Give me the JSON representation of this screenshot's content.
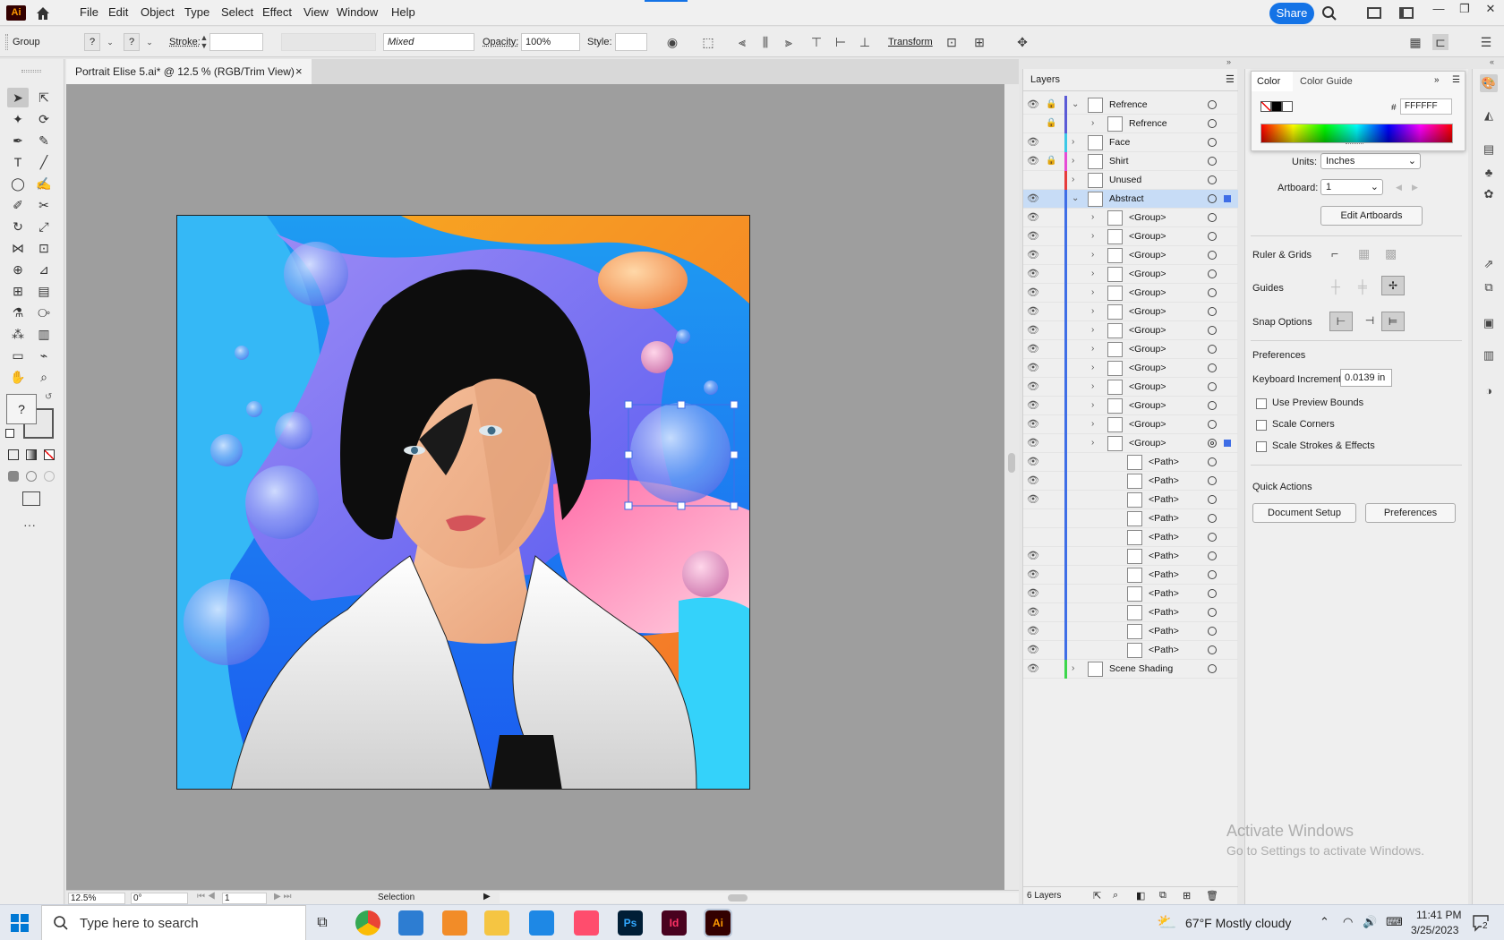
{
  "app": {
    "logo": "Ai",
    "home_icon": "home-icon"
  },
  "menu": [
    "File",
    "Edit",
    "Object",
    "Type",
    "Select",
    "Effect",
    "View",
    "Window",
    "Help"
  ],
  "topbar": {
    "share": "Share"
  },
  "control": {
    "selection_type": "Group",
    "fill_q": "?",
    "stroke_q": "?",
    "stroke_label": "Stroke:",
    "mixed": "Mixed",
    "opacity_label": "Opacity:",
    "opacity_value": "100%",
    "style_label": "Style:",
    "transform": "Transform"
  },
  "document": {
    "tab_title": "Portrait Elise 5.ai* @ 12.5 % (RGB/Trim View)",
    "close": "×"
  },
  "status": {
    "zoom": "12.5%",
    "rotation": "0°",
    "artboard": "1",
    "tool": "Selection"
  },
  "layers": {
    "panel_title": "Layers",
    "count": "6 Layers",
    "rows": [
      {
        "name": "Refrence",
        "eye": true,
        "lock": true,
        "expanded": true,
        "color": "#5b5bd6",
        "indent": 0
      },
      {
        "name": "Refrence",
        "eye": false,
        "lock": true,
        "color": "#5b5bd6",
        "indent": 1
      },
      {
        "name": "Face",
        "eye": true,
        "lock": false,
        "color": "#3cc8e6",
        "indent": 0
      },
      {
        "name": "Shirt",
        "eye": true,
        "lock": true,
        "color": "#e64bd6",
        "indent": 0
      },
      {
        "name": "Unused",
        "eye": false,
        "lock": false,
        "color": "#e63c3c",
        "indent": 0
      },
      {
        "name": "Abstract",
        "eye": true,
        "lock": false,
        "expanded": true,
        "color": "#3f6ee6",
        "indent": 0,
        "selected": true
      },
      {
        "name": "<Group>",
        "eye": true,
        "color": "#3f6ee6",
        "indent": 1
      },
      {
        "name": "<Group>",
        "eye": true,
        "color": "#3f6ee6",
        "indent": 1
      },
      {
        "name": "<Group>",
        "eye": true,
        "color": "#3f6ee6",
        "indent": 1
      },
      {
        "name": "<Group>",
        "eye": true,
        "color": "#3f6ee6",
        "indent": 1
      },
      {
        "name": "<Group>",
        "eye": true,
        "color": "#3f6ee6",
        "indent": 1
      },
      {
        "name": "<Group>",
        "eye": true,
        "color": "#3f6ee6",
        "indent": 1
      },
      {
        "name": "<Group>",
        "eye": true,
        "color": "#3f6ee6",
        "indent": 1
      },
      {
        "name": "<Group>",
        "eye": true,
        "color": "#3f6ee6",
        "indent": 1
      },
      {
        "name": "<Group>",
        "eye": true,
        "color": "#3f6ee6",
        "indent": 1
      },
      {
        "name": "<Group>",
        "eye": true,
        "color": "#3f6ee6",
        "indent": 1
      },
      {
        "name": "<Group>",
        "eye": true,
        "color": "#3f6ee6",
        "indent": 1
      },
      {
        "name": "<Group>",
        "eye": true,
        "color": "#3f6ee6",
        "indent": 1
      },
      {
        "name": "<Group>",
        "eye": true,
        "color": "#3f6ee6",
        "indent": 1,
        "targeted": true
      },
      {
        "name": "<Path>",
        "eye": true,
        "color": "#3f6ee6",
        "indent": 2
      },
      {
        "name": "<Path>",
        "eye": true,
        "color": "#3f6ee6",
        "indent": 2
      },
      {
        "name": "<Path>",
        "eye": true,
        "color": "#3f6ee6",
        "indent": 2
      },
      {
        "name": "<Path>",
        "eye": false,
        "color": "#3f6ee6",
        "indent": 2
      },
      {
        "name": "<Path>",
        "eye": false,
        "color": "#3f6ee6",
        "indent": 2
      },
      {
        "name": "<Path>",
        "eye": true,
        "color": "#3f6ee6",
        "indent": 2
      },
      {
        "name": "<Path>",
        "eye": true,
        "color": "#3f6ee6",
        "indent": 2
      },
      {
        "name": "<Path>",
        "eye": true,
        "color": "#3f6ee6",
        "indent": 2
      },
      {
        "name": "<Path>",
        "eye": true,
        "color": "#3f6ee6",
        "indent": 2
      },
      {
        "name": "<Path>",
        "eye": true,
        "color": "#3f6ee6",
        "indent": 2
      },
      {
        "name": "<Path>",
        "eye": true,
        "color": "#3f6ee6",
        "indent": 2
      },
      {
        "name": "Scene Shading",
        "eye": true,
        "lock": false,
        "color": "#3cd64b",
        "indent": 0
      }
    ]
  },
  "color_panel": {
    "tab_color": "Color",
    "tab_guide": "Color Guide",
    "hash": "#",
    "hex": "FFFFFF"
  },
  "properties": {
    "units_label": "Units:",
    "units_value": "Inches",
    "artboard_label": "Artboard:",
    "artboard_value": "1",
    "edit_artboards": "Edit Artboards",
    "ruler_grids": "Ruler & Grids",
    "guides": "Guides",
    "snap_options": "Snap Options",
    "preferences_heading": "Preferences",
    "keyboard_increment_label": "Keyboard Increment:",
    "keyboard_increment_value": "0.0139 in",
    "use_preview_bounds": "Use Preview Bounds",
    "scale_corners": "Scale Corners",
    "scale_strokes": "Scale Strokes & Effects",
    "quick_actions": "Quick Actions",
    "document_setup": "Document Setup",
    "preferences_btn": "Preferences"
  },
  "watermark": {
    "line1": "Activate Windows",
    "line2": "Go to Settings to activate Windows."
  },
  "taskbar": {
    "search_placeholder": "Type here to search",
    "weather": "67°F  Mostly cloudy",
    "time": "11:41 PM",
    "date": "3/25/2023",
    "notifications": "2",
    "apps": [
      {
        "name": "chrome",
        "label": "",
        "color": "#ffffff"
      },
      {
        "name": "photos",
        "label": "",
        "color": "#2d7dd2"
      },
      {
        "name": "fl-studio",
        "label": "",
        "color": "#f28c28"
      },
      {
        "name": "file-explorer",
        "label": "",
        "color": "#f5c542"
      },
      {
        "name": "photos-app",
        "label": "",
        "color": "#1e88e5"
      },
      {
        "name": "creative-cloud",
        "label": "",
        "color": "#ff4d6d"
      },
      {
        "name": "photoshop",
        "label": "Ps",
        "color": "#001e36"
      },
      {
        "name": "indesign",
        "label": "Id",
        "color": "#49021f"
      },
      {
        "name": "illustrator",
        "label": "Ai",
        "color": "#330000"
      }
    ]
  }
}
